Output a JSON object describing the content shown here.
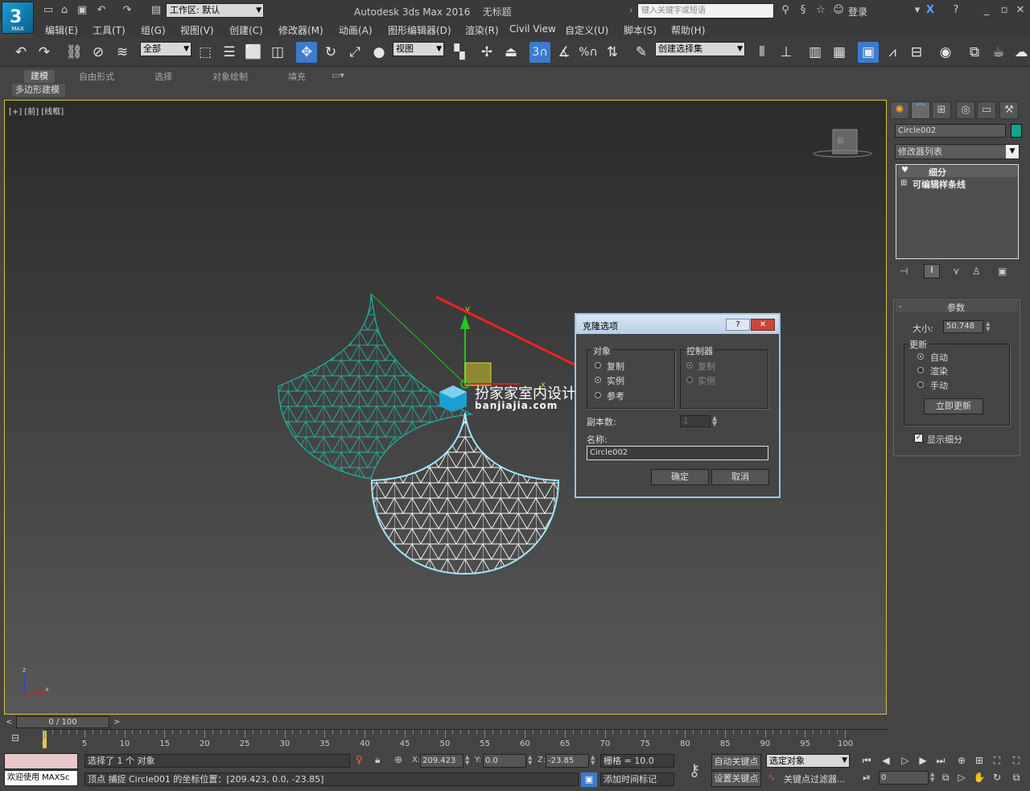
{
  "app": {
    "title": "Autodesk 3ds Max 2016",
    "doc_title": "无标题",
    "workspace": "工作区: 默认",
    "search_placeholder": "键入关键字或短语",
    "login": "登录",
    "logo_text": "MAX"
  },
  "menu": [
    "编辑(E)",
    "工具(T)",
    "组(G)",
    "视图(V)",
    "创建(C)",
    "修改器(M)",
    "动画(A)",
    "图形编辑器(D)",
    "渲染(R)",
    "Civil View",
    "自定义(U)",
    "脚本(S)",
    "帮助(H)"
  ],
  "toolbar": {
    "filter": "全部",
    "ref_coord": "视图",
    "selection_set": "创建选择集"
  },
  "ribbon": {
    "tabs": [
      "建模",
      "自由形式",
      "选择",
      "对象绘制",
      "填充"
    ],
    "subtab": "多边形建模"
  },
  "viewport": {
    "label": "[+] [前] [线框]",
    "watermark_cn": "扮家家室内设计",
    "watermark_url": "banjiajia.com",
    "viewcube_label": "前"
  },
  "command_panel": {
    "object_name": "Circle002",
    "object_color": "#12a58b",
    "modifier_list": "修改器列表",
    "stack": [
      "细分",
      "可编辑样条线"
    ],
    "rollout_title": "参数",
    "size_label": "大小:",
    "size_value": "50.748",
    "update_group": "更新",
    "update_options": [
      "自动",
      "渲染",
      "手动"
    ],
    "update_selected": 0,
    "update_now": "立即更新",
    "show_subdiv": "显示细分",
    "show_subdiv_checked": true
  },
  "dialog": {
    "title": "克隆选项",
    "object_group": "对象",
    "object_options": [
      "复制",
      "实例",
      "参考"
    ],
    "object_selected": 1,
    "controller_group": "控制器",
    "controller_options": [
      "复制",
      "实例"
    ],
    "controller_selected": 0,
    "copies_label": "副本数:",
    "copies_value": "1",
    "name_label": "名称:",
    "name_value": "Circle002",
    "ok": "确定",
    "cancel": "取消"
  },
  "timeline": {
    "frame": "0 / 100",
    "ticks": [
      "0",
      "5",
      "10",
      "15",
      "20",
      "25",
      "30",
      "35",
      "40",
      "45",
      "50",
      "55",
      "60",
      "65",
      "70",
      "75",
      "80",
      "85",
      "90",
      "95",
      "100"
    ]
  },
  "status": {
    "welcome": "欢迎使用 MAXSc",
    "selected": "选择了 1 个 对象",
    "prompt": "顶点 捕捉 Circle001 的坐标位置：[209.423, 0.0, -23.85]",
    "x_label": "X:",
    "x": "209.423",
    "y_label": "Y:",
    "y": "0.0",
    "z_label": "Z:",
    "z": "-23.85",
    "grid": "栅格 = 10.0",
    "add_time_tag": "添加时间标记",
    "auto_key": "自动关键点",
    "set_key": "设置关键点",
    "key_mode": "选定对象",
    "key_filters": "关键点过滤器...",
    "frame_field": "0"
  }
}
